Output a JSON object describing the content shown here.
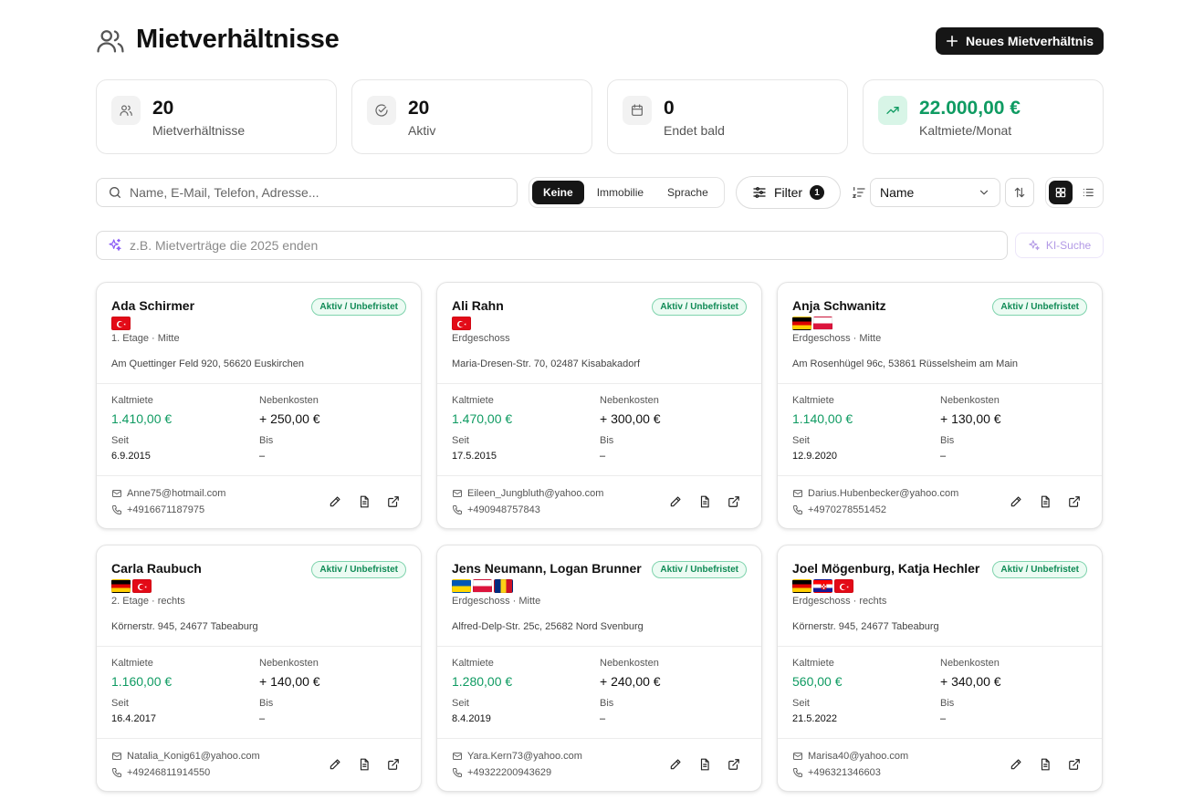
{
  "header": {
    "title": "Mietverhältnisse",
    "new_button": "Neues Mietverhältnis"
  },
  "stats": [
    {
      "value": "20",
      "label": "Mietverhältnisse",
      "icon": "users-icon"
    },
    {
      "value": "20",
      "label": "Aktiv",
      "icon": "check-circle-icon"
    },
    {
      "value": "0",
      "label": "Endet bald",
      "icon": "calendar-icon"
    },
    {
      "value": "22.000,00 €",
      "label": "Kaltmiete/Monat",
      "icon": "trending-up-icon",
      "accent": "#0f9b62"
    }
  ],
  "toolbar": {
    "search_placeholder": "Name, E-Mail, Telefon, Adresse...",
    "group_options": [
      "Keine",
      "Immobilie",
      "Sprache"
    ],
    "group_selected": "Keine",
    "filter_label": "Filter",
    "filter_count": "1",
    "sort_value": "Name",
    "view_selected": "grid"
  },
  "ai": {
    "placeholder": "z.B. Mietverträge die 2025 enden",
    "button": "KI-Suche"
  },
  "labels": {
    "kaltmiete": "Kaltmiete",
    "nebenkosten": "Nebenkosten",
    "seit": "Seit",
    "bis": "Bis"
  },
  "cards": [
    {
      "name": "Ada Schirmer",
      "status": "Aktiv / Unbefristet",
      "flags": [
        "tr"
      ],
      "floor": "1. Etage · Mitte",
      "address": "Am Quettinger Feld 920, 56620 Euskirchen",
      "kaltmiete": "1.410,00 €",
      "nebenkosten": "+ 250,00 €",
      "seit": "6.9.2015",
      "bis": "–",
      "email": "Anne75@hotmail.com",
      "phone": "+4916671187975"
    },
    {
      "name": "Ali Rahn",
      "status": "Aktiv / Unbefristet",
      "flags": [
        "tr"
      ],
      "floor": "Erdgeschoss",
      "address": "Maria-Dresen-Str. 70, 02487 Kisabakadorf",
      "kaltmiete": "1.470,00 €",
      "nebenkosten": "+ 300,00 €",
      "seit": "17.5.2015",
      "bis": "–",
      "email": "Eileen_Jungbluth@yahoo.com",
      "phone": "+490948757843"
    },
    {
      "name": "Anja Schwanitz",
      "status": "Aktiv / Unbefristet",
      "flags": [
        "de",
        "pl"
      ],
      "floor": "Erdgeschoss · Mitte",
      "address": "Am Rosenhügel 96c, 53861 Rüsselsheim am Main",
      "kaltmiete": "1.140,00 €",
      "nebenkosten": "+ 130,00 €",
      "seit": "12.9.2020",
      "bis": "–",
      "email": "Darius.Hubenbecker@yahoo.com",
      "phone": "+4970278551452"
    },
    {
      "name": "Carla Raubuch",
      "status": "Aktiv / Unbefristet",
      "flags": [
        "de",
        "tr"
      ],
      "floor": "2. Etage · rechts",
      "address": "Körnerstr. 945, 24677 Tabeaburg",
      "kaltmiete": "1.160,00 €",
      "nebenkosten": "+ 140,00 €",
      "seit": "16.4.2017",
      "bis": "–",
      "email": "Natalia_Konig61@yahoo.com",
      "phone": "+49246811914550"
    },
    {
      "name": "Jens Neumann, Logan Brunner",
      "status": "Aktiv / Unbefristet",
      "flags": [
        "ua",
        "pl",
        "ro"
      ],
      "floor": "Erdgeschoss · Mitte",
      "address": "Alfred-Delp-Str. 25c, 25682 Nord Svenburg",
      "kaltmiete": "1.280,00 €",
      "nebenkosten": "+ 240,00 €",
      "seit": "8.4.2019",
      "bis": "–",
      "email": "Yara.Kern73@yahoo.com",
      "phone": "+49322200943629"
    },
    {
      "name": "Joel Mögenburg, Katja Hechler",
      "status": "Aktiv / Unbefristet",
      "flags": [
        "de",
        "hr",
        "tr"
      ],
      "floor": "Erdgeschoss · rechts",
      "address": "Körnerstr. 945, 24677 Tabeaburg",
      "kaltmiete": "560,00 €",
      "nebenkosten": "+ 340,00 €",
      "seit": "21.5.2022",
      "bis": "–",
      "email": "Marisa40@yahoo.com",
      "phone": "+496321346603"
    }
  ]
}
